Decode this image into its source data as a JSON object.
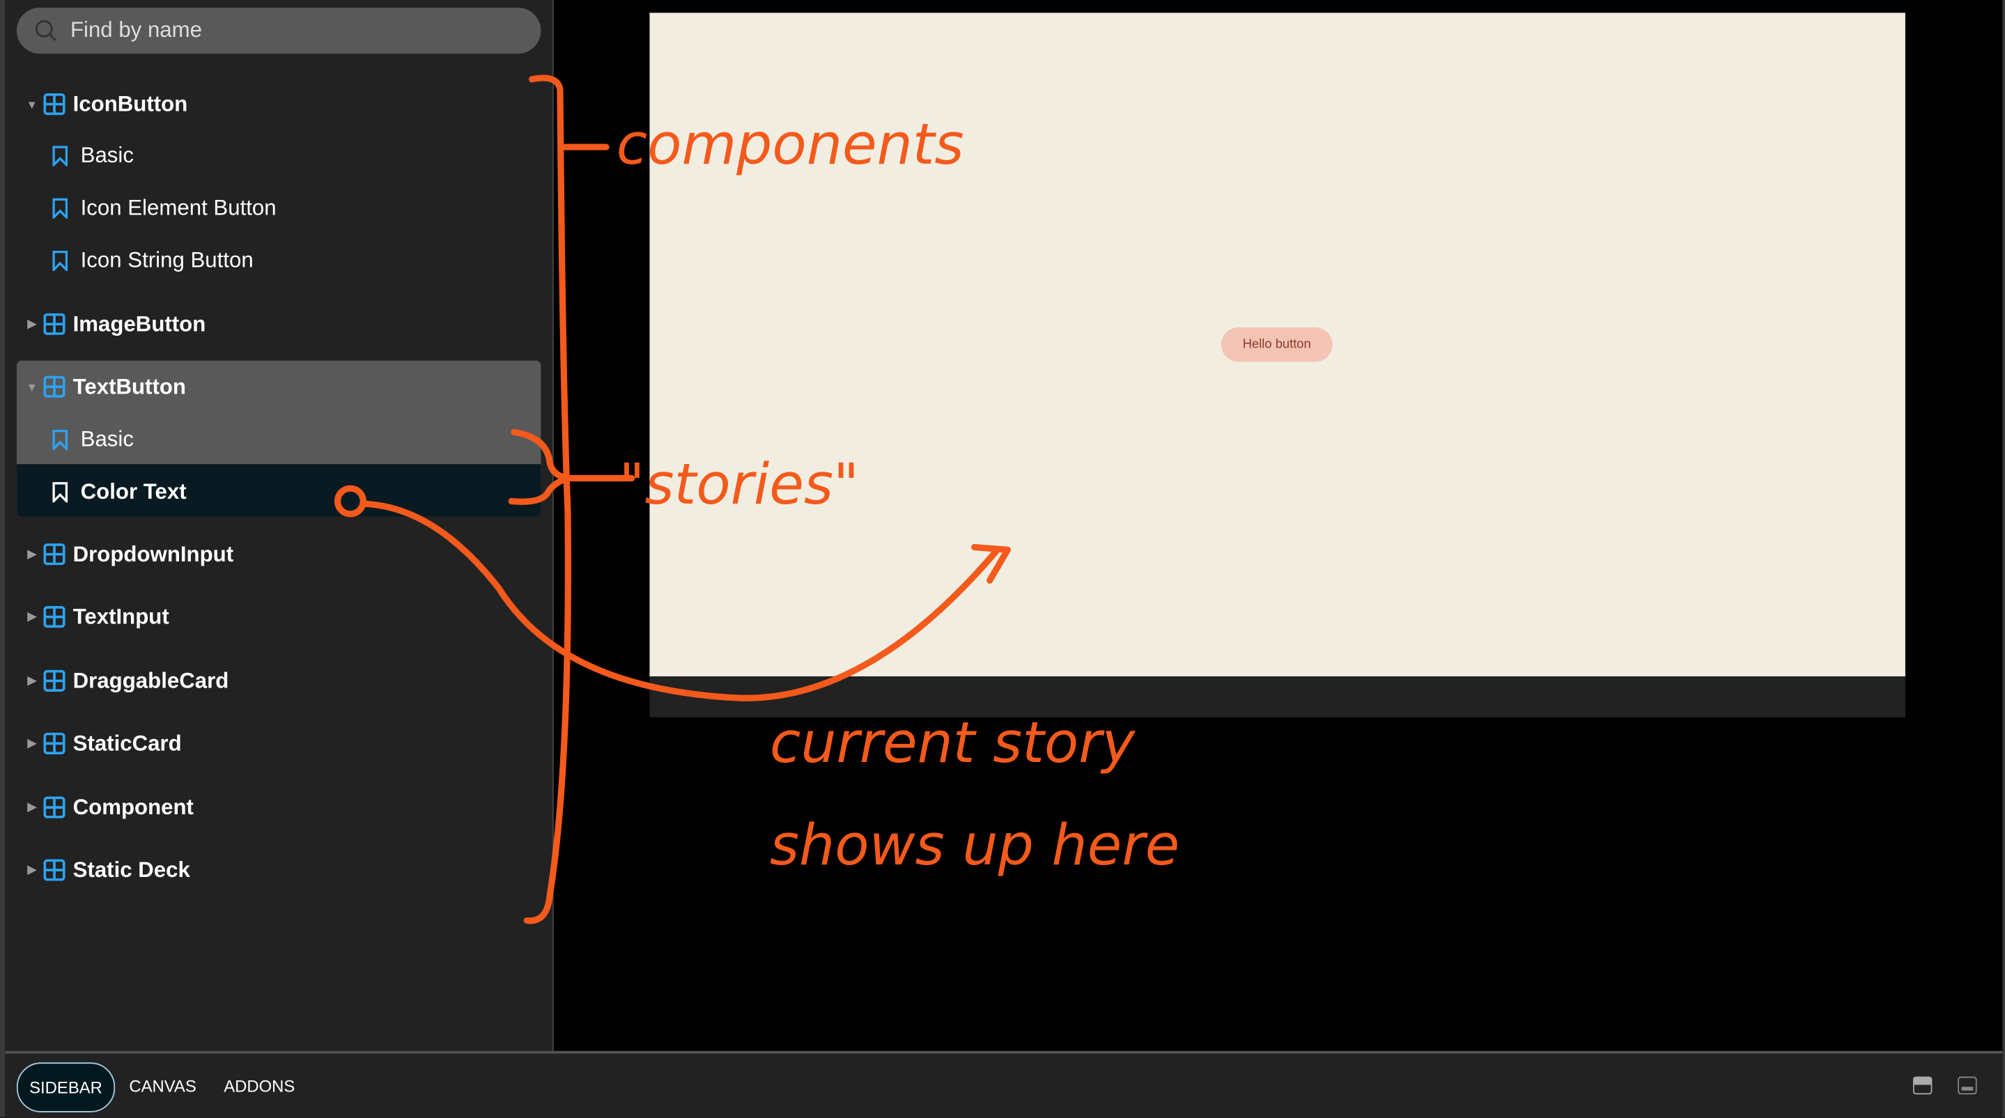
{
  "search": {
    "placeholder": "Find by name"
  },
  "tree": [
    {
      "label": "IconButton",
      "expanded": true,
      "stories": [
        "Basic",
        "Icon Element Button",
        "Icon String Button"
      ]
    },
    {
      "label": "ImageButton",
      "expanded": false
    },
    {
      "label": "TextButton",
      "expanded": true,
      "stories": [
        "Basic",
        "Color Text"
      ],
      "selected_story": "Color Text"
    },
    {
      "label": "DropdownInput",
      "expanded": false
    },
    {
      "label": "TextInput",
      "expanded": false
    },
    {
      "label": "DraggableCard",
      "expanded": false
    },
    {
      "label": "StaticCard",
      "expanded": false
    },
    {
      "label": "Component",
      "expanded": false
    },
    {
      "label": "Static Deck",
      "expanded": false
    }
  ],
  "preview": {
    "button_label": "Hello button"
  },
  "bottom_tabs": [
    "SIDEBAR",
    "CANVAS",
    "ADDONS"
  ],
  "annotations": {
    "components": "components",
    "stories": "\"stories\"",
    "current_line1": "current story",
    "current_line2": "shows up here"
  },
  "colors": {
    "accent": "#2ea3f2",
    "annotation": "#f35a1c",
    "preview_bg": "#f2ede1"
  }
}
